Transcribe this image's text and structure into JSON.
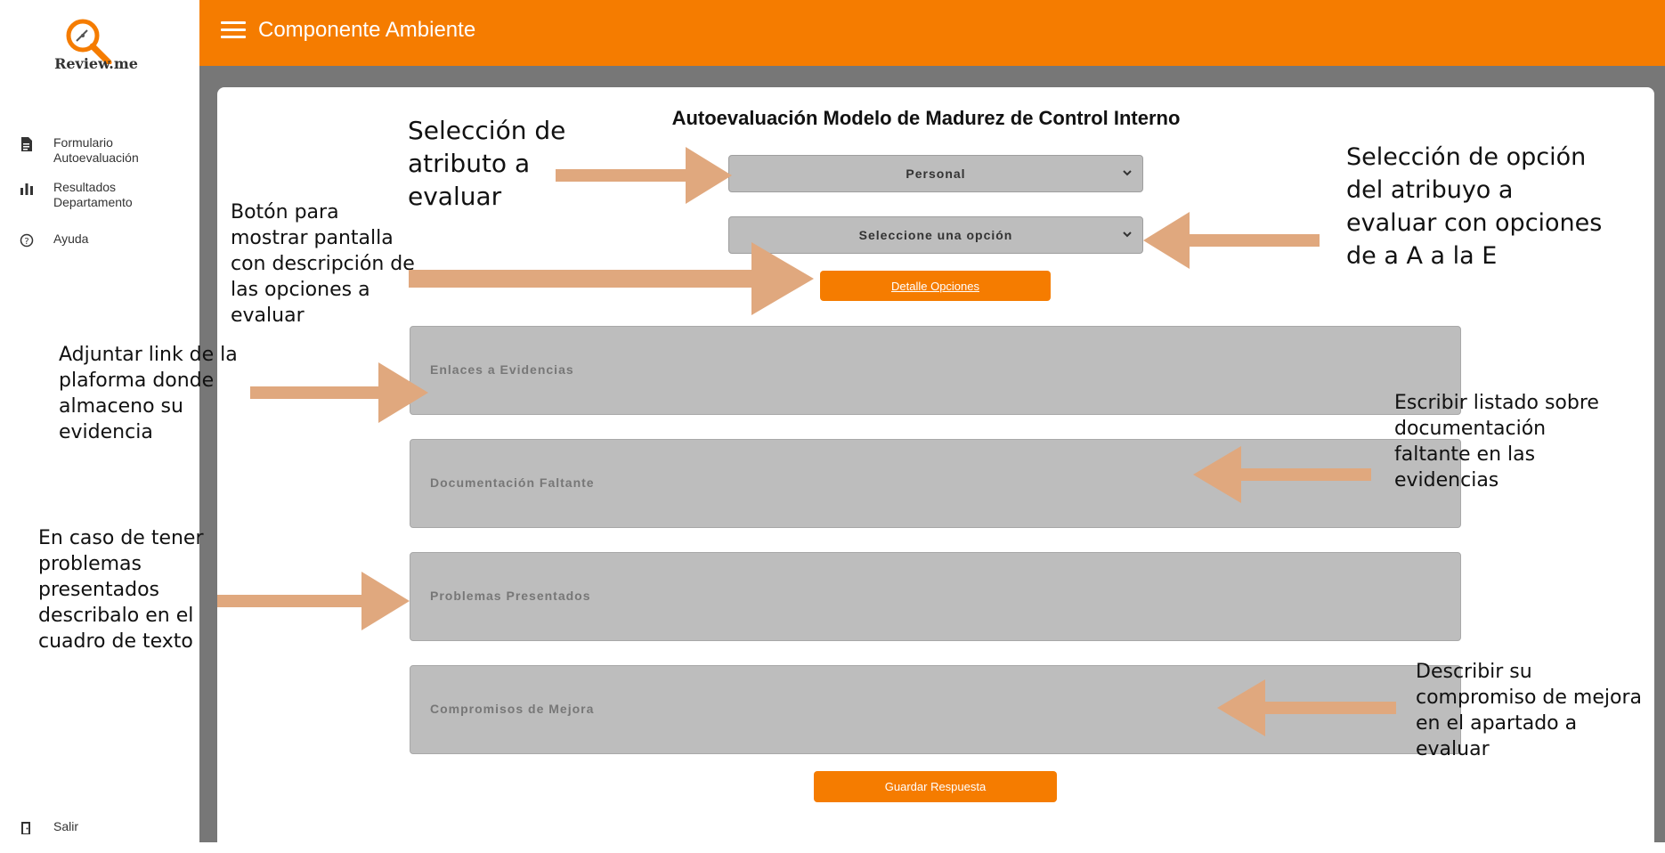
{
  "app": {
    "logo_text": "Review.me"
  },
  "sidebar": {
    "items": [
      {
        "label": "Formulario Autoevaluación",
        "icon": "document-icon"
      },
      {
        "label": "Resultados Departamento",
        "icon": "bar-chart-icon"
      },
      {
        "label": "Ayuda",
        "icon": "help-circle-icon"
      }
    ],
    "logout_label": "Salir"
  },
  "header": {
    "title": "Componente Ambiente"
  },
  "form": {
    "title": "Autoevaluación Modelo de Madurez de Control Interno",
    "attribute_select_value": "Personal",
    "option_select_value": "Seleccione una opción",
    "detail_button": "Detalle Opciones",
    "evidence_links_placeholder": "Enlaces a Evidencias",
    "missing_docs_placeholder": "Documentación Faltante",
    "problems_placeholder": "Problemas Presentados",
    "commitments_placeholder": "Compromisos de Mejora",
    "save_button": "Guardar Respuesta"
  },
  "annotations": {
    "select_attribute": "Selección de atributo a evaluar",
    "select_option": "Selección de opción del atribuyo a evaluar con opciones de a A a la E",
    "detail_button": "Botón para mostrar pantalla con descripción de las opciones a evaluar",
    "evidence_links": "Adjuntar link de la plaforma donde almaceno su evidencia",
    "missing_docs": "Escribir listado sobre documentación faltante en las evidencias",
    "problems": "En caso de tener problemas presentados describalo en el cuadro de texto",
    "commitments": "Describir su compromiso de mejora en el apartado a evaluar"
  },
  "colors": {
    "accent": "#f57c00",
    "arrow": "#e0a87e",
    "field_bg": "#bdbdbd",
    "frame_bg": "#777777"
  }
}
